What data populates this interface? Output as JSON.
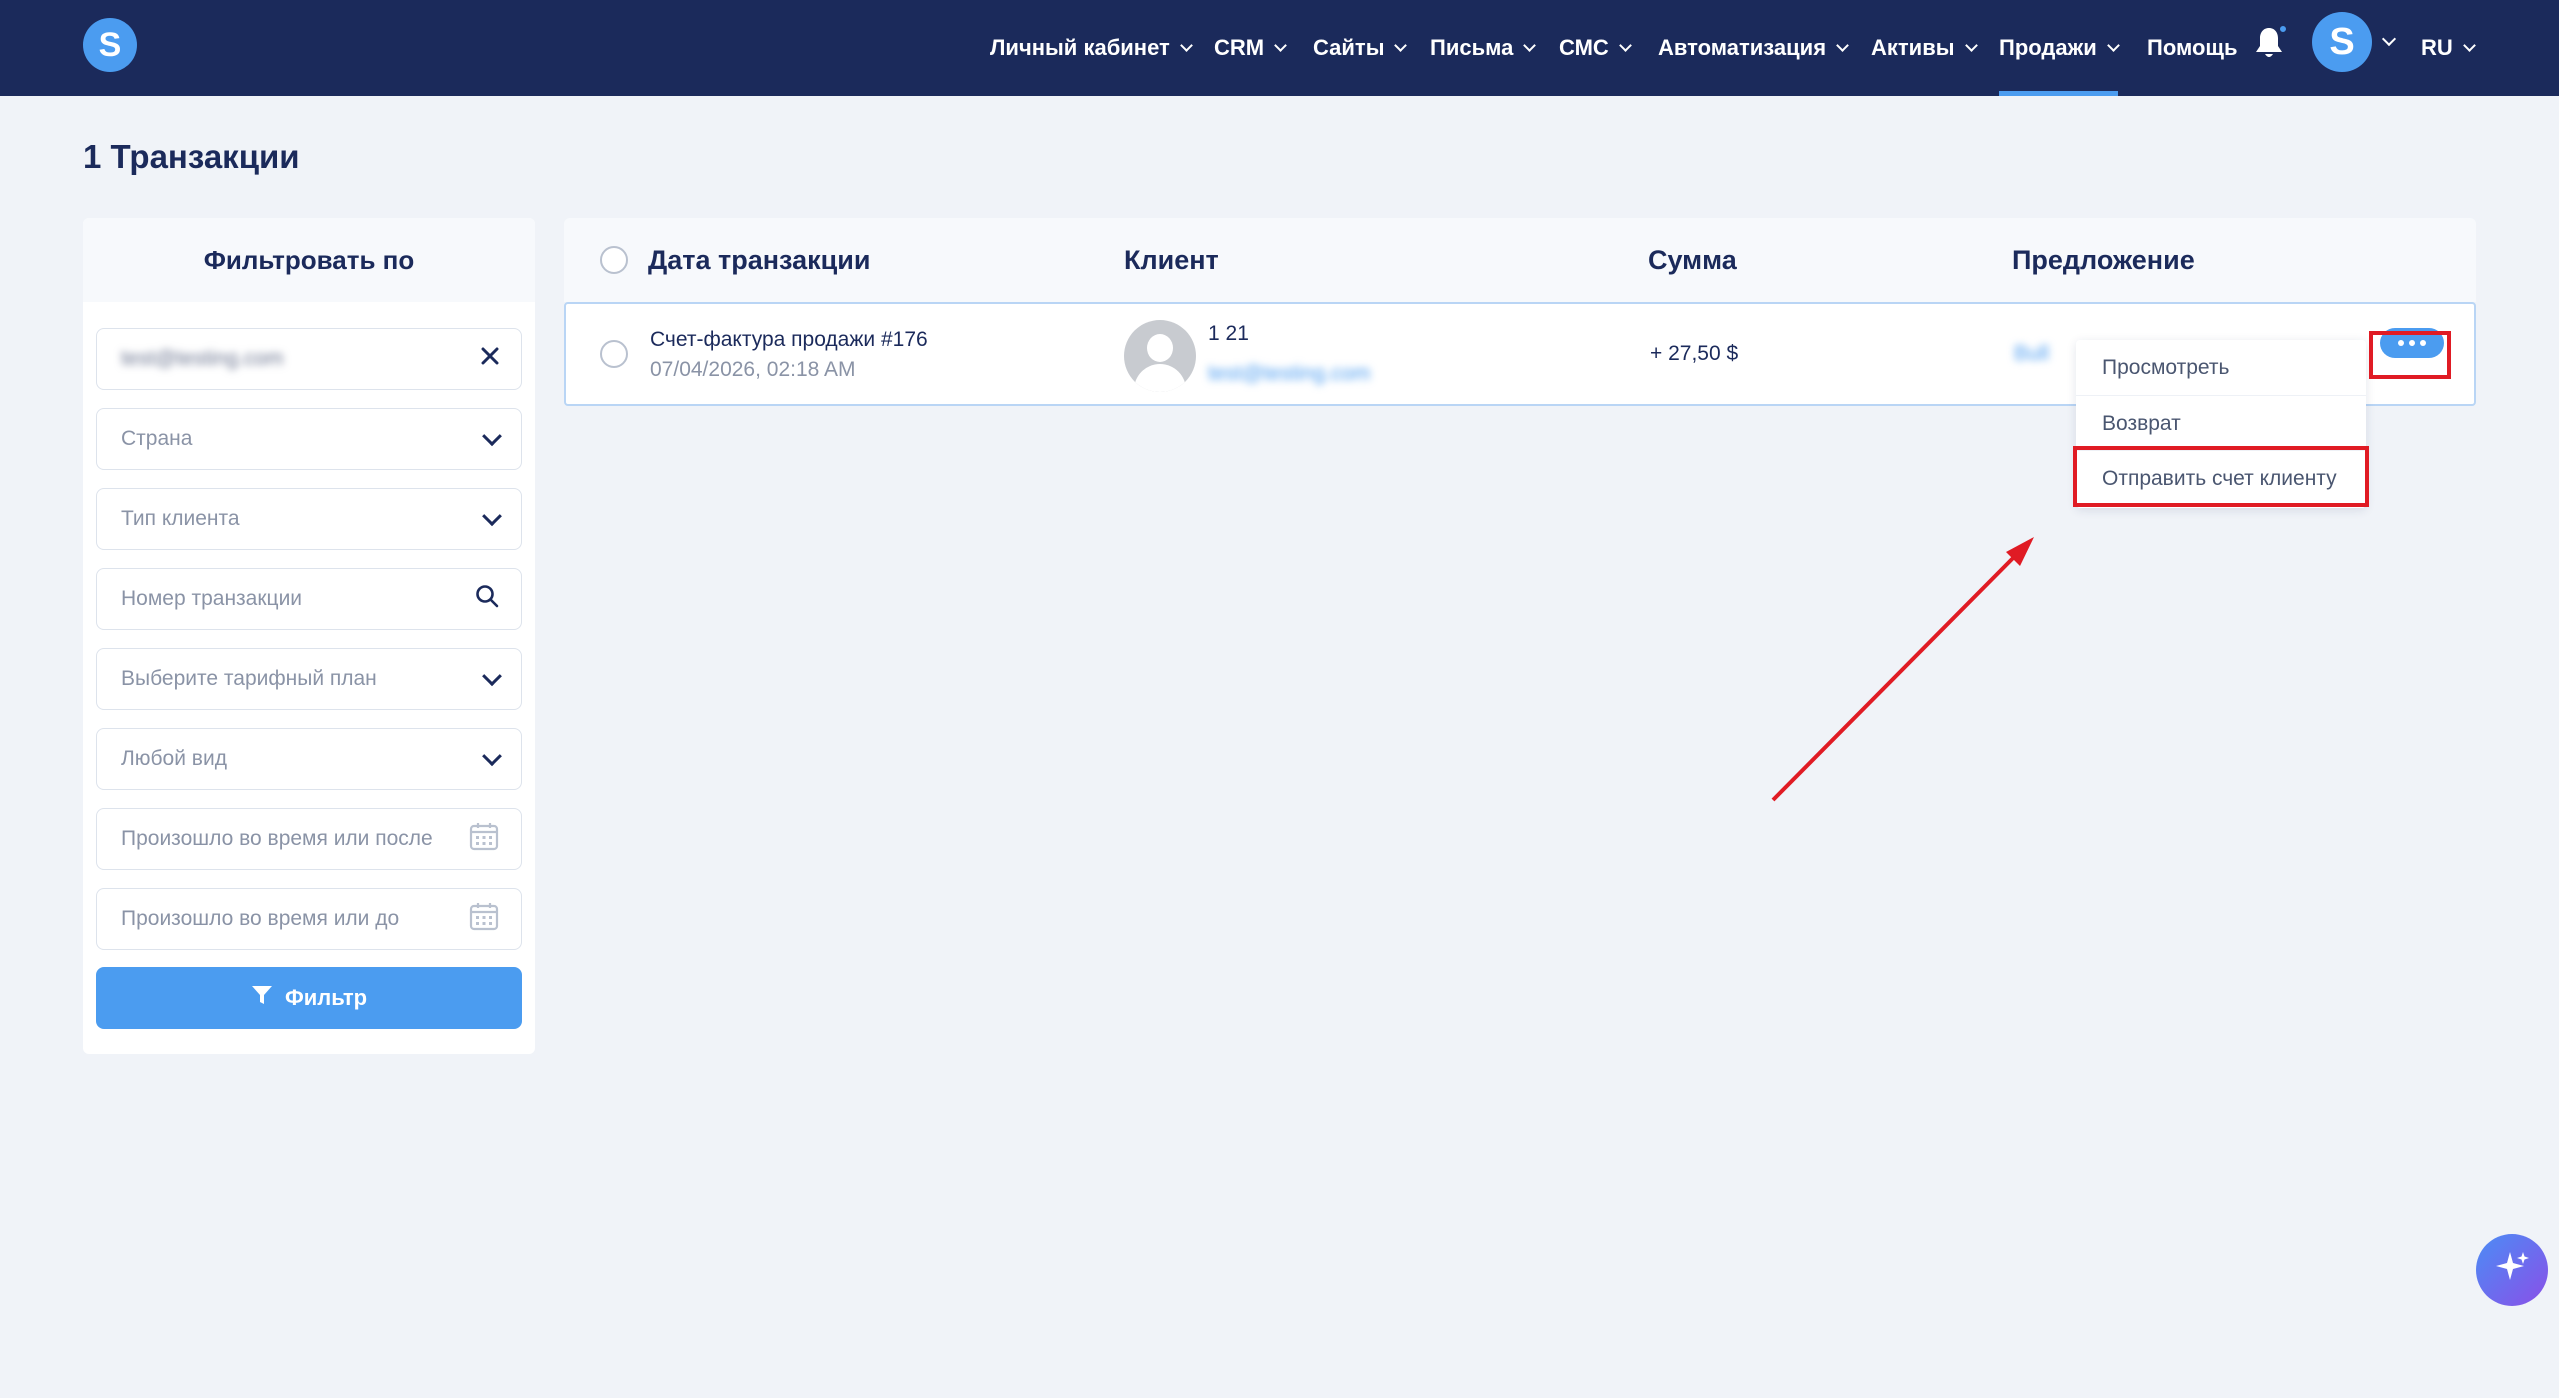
{
  "brand": {
    "logo_letter": "S"
  },
  "nav": {
    "items": [
      {
        "label": "Личный кабинет",
        "has_dropdown": true
      },
      {
        "label": "CRM",
        "has_dropdown": true
      },
      {
        "label": "Сайты",
        "has_dropdown": true
      },
      {
        "label": "Письма",
        "has_dropdown": true
      },
      {
        "label": "СМС",
        "has_dropdown": true
      },
      {
        "label": "Автоматизация",
        "has_dropdown": true
      },
      {
        "label": "Активы",
        "has_dropdown": true
      },
      {
        "label": "Продажи",
        "has_dropdown": true,
        "active": true
      },
      {
        "label": "Помощь",
        "has_dropdown": false
      }
    ],
    "user_avatar_letter": "S",
    "language": "RU"
  },
  "page": {
    "title": "1 Транзакции"
  },
  "filter": {
    "heading": "Фильтровать по",
    "email_value": "test@testing.com",
    "country_placeholder": "Страна",
    "client_type_placeholder": "Тип клиента",
    "transaction_number_placeholder": "Номер транзакции",
    "plan_placeholder": "Выберите тарифный план",
    "kind_placeholder": "Любой вид",
    "date_after_placeholder": "Произошло во время или после",
    "date_before_placeholder": "Произошло во время или до",
    "button_label": "Фильтр"
  },
  "table": {
    "columns": [
      "Дата транзакции",
      "Клиент",
      "Сумма",
      "Предложение"
    ],
    "rows": [
      {
        "title": "Счет-фактура продажи #176",
        "date": "07/04/2026, 02:18 AM",
        "client_name": "1 21",
        "client_email": "test@testing.com",
        "amount": "+ 27,50 $",
        "offer": "Bull"
      }
    ]
  },
  "row_menu": {
    "items": [
      "Просмотреть",
      "Возврат",
      "Отправить счет клиенту"
    ]
  },
  "colors": {
    "nav_bg": "#1b2a5b",
    "accent": "#4b9cf0",
    "highlight": "#e01b24"
  }
}
